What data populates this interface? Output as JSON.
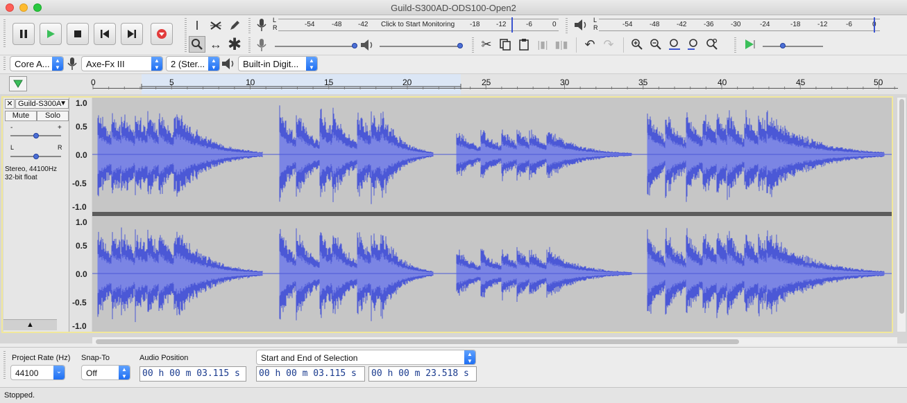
{
  "window": {
    "title": "Guild-S300AD-ODS100-Open2"
  },
  "transport": {
    "pause": "pause-icon",
    "play": "play-icon",
    "stop": "stop-icon",
    "skip_start": "skip-start-icon",
    "skip_end": "skip-end-icon",
    "record": "record-icon"
  },
  "meters": {
    "record_scale": [
      "-54",
      "-48",
      "-42",
      "-18",
      "-12",
      "-6",
      "0"
    ],
    "record_hint": "Click to Start Monitoring",
    "play_scale": [
      "-54",
      "-48",
      "-42",
      "-36",
      "-30",
      "-24",
      "-18",
      "-12",
      "-6",
      "0"
    ],
    "lr": [
      "L",
      "R"
    ]
  },
  "device": {
    "host": "Core A...",
    "input_device": "Axe-Fx III",
    "channels": "2 (Ster...",
    "output_device": "Built-in Digit..."
  },
  "ruler": {
    "ticks": [
      "0",
      "5",
      "10",
      "15",
      "20",
      "25",
      "30",
      "35",
      "40",
      "45",
      "50"
    ]
  },
  "track": {
    "name": "Guild-S300A",
    "mute": "Mute",
    "solo": "Solo",
    "gain_minus": "-",
    "gain_plus": "+",
    "pan_l": "L",
    "pan_r": "R",
    "info_line1": "Stereo, 44100Hz",
    "info_line2": "32-bit float",
    "scale": [
      "1.0",
      "0.5",
      "0.0",
      "-0.5",
      "-1.0"
    ],
    "colors": {
      "waveform": "#4b58d6",
      "waveform_rms": "#7b85e4",
      "background": "#c6c6c6"
    }
  },
  "selection_bar": {
    "project_rate_label": "Project Rate (Hz)",
    "project_rate_value": "44100",
    "snap_to_label": "Snap-To",
    "snap_to_value": "Off",
    "audio_position_label": "Audio Position",
    "audio_position_value": "00 h 00 m 03.115 s",
    "selection_mode": "Start and End of Selection",
    "selection_start": "00 h 00 m 03.115 s",
    "selection_end": "00 h 00 m 23.518 s"
  },
  "status": {
    "text": "Stopped."
  }
}
